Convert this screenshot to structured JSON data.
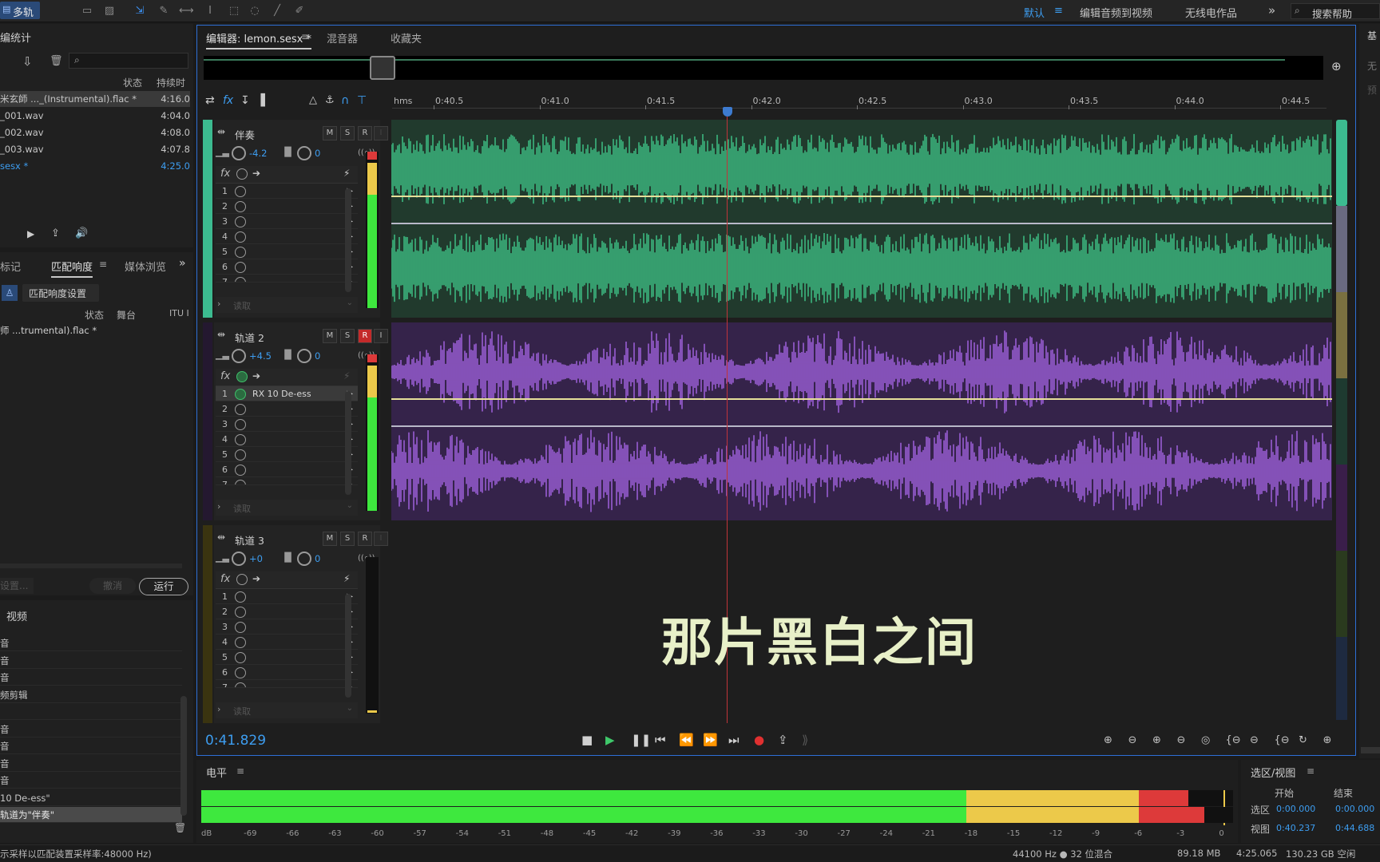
{
  "topbar": {
    "mode_label": "多轨",
    "workspaces": [
      "默认",
      "编辑音频到视频",
      "无线电作品"
    ],
    "more": "»",
    "search_placeholder": "搜索帮助"
  },
  "files_panel": {
    "title": "编统计",
    "col_status": "状态",
    "col_duration": "持续时",
    "rows": [
      {
        "name": "米玄師 ..._(Instrumental).flac *",
        "dur": "4:16.0",
        "selected": true
      },
      {
        "name": "_001.wav",
        "dur": "4:04.0"
      },
      {
        "name": "_002.wav",
        "dur": "4:08.0"
      },
      {
        "name": "_003.wav",
        "dur": "4:07.8"
      },
      {
        "name": "sesx *",
        "dur": "4:25.0",
        "blue": true
      }
    ]
  },
  "loudness_panel": {
    "tabs": [
      "标记",
      "匹配响度",
      "媒体浏览"
    ],
    "settings_label": "匹配响度设置",
    "cols": [
      "状态",
      "舞台",
      "ITU I"
    ],
    "row": "师 ...trumental).flac *",
    "btn_settings": "设置...",
    "btn_undo": "撤消",
    "btn_run": "运行"
  },
  "history_panel": {
    "title": "视频",
    "rows": [
      "音",
      "音",
      "音",
      "频剪辑",
      "",
      "音",
      "音",
      "音",
      "音",
      "10 De-ess\"",
      "轨道为\"伴奏\""
    ]
  },
  "editor": {
    "tabs": [
      "编辑器: lemon.sesx *",
      "混音器",
      "收藏夹"
    ],
    "ruler_unit": "hms",
    "ruler": [
      "0:40.5",
      "0:41.0",
      "0:41.5",
      "0:42.0",
      "0:42.5",
      "0:43.0",
      "0:43.5",
      "0:44.0",
      "0:44.5"
    ],
    "time": "0:41.829",
    "subtitle": "那片黑白之间"
  },
  "tracks": [
    {
      "name": "伴奏",
      "volume": "-4.2",
      "pan": "0",
      "rec": false,
      "read": "读取",
      "fx": [],
      "color": "#2b6b4b",
      "wave": "#3fc88a",
      "bg": "#213a2d"
    },
    {
      "name": "轨道 2",
      "volume": "+4.5",
      "pan": "0",
      "rec": true,
      "read": "读取",
      "fx": [
        "RX 10 De-ess"
      ],
      "color": "#5a3a78",
      "wave": "#a765e6",
      "bg": "#35234a"
    },
    {
      "name": "轨道 3",
      "volume": "+0",
      "pan": "0",
      "rec": false,
      "read": "读取",
      "fx": [],
      "color": "#5a5020",
      "wave": "",
      "bg": "#1e1e1e"
    }
  ],
  "msr": {
    "m": "M",
    "s": "S",
    "r": "R",
    "i": "I"
  },
  "level_panel": {
    "title": "电平",
    "scale": [
      "dB",
      "-69",
      "-66",
      "-63",
      "-60",
      "-57",
      "-54",
      "-51",
      "-48",
      "-45",
      "-42",
      "-39",
      "-36",
      "-33",
      "-30",
      "-27",
      "-24",
      "-21",
      "-18",
      "-15",
      "-12",
      "-9",
      "-6",
      "-3",
      "0"
    ]
  },
  "selection_panel": {
    "title": "选区/视图",
    "col_start": "开始",
    "col_end": "结束",
    "rows": [
      {
        "label": "选区",
        "start": "0:00.000",
        "end": "0:00.000"
      },
      {
        "label": "视图",
        "start": "0:40.237",
        "end": "0:44.688"
      }
    ]
  },
  "statusbar": {
    "left": "示采样以匹配装置采样率:48000 Hz)",
    "rate": "44100 Hz ● 32 位混合",
    "mem": "89.18 MB",
    "dur": "4:25.065",
    "free": "130.23 GB 空闲"
  }
}
